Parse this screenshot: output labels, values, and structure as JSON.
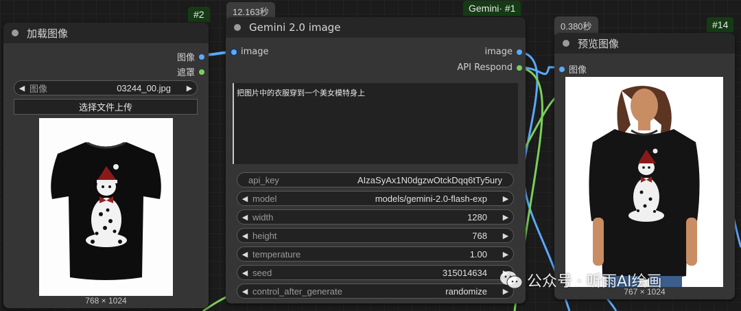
{
  "load_node": {
    "badge": "#2",
    "title": "加载图像",
    "outputs": [
      "图像",
      "遮罩"
    ],
    "image_widget": {
      "label": "图像",
      "value": "03244_00.jpg"
    },
    "upload_label": "选择文件上传",
    "image_dims": "768 × 1024"
  },
  "gemini_node": {
    "badge": "Gemini·  #1",
    "time": "12.163秒",
    "title": "Gemini 2.0 image",
    "input": "image",
    "outputs": [
      "image",
      "API Respond"
    ],
    "prompt": "把图片中的衣服穿到一个美女模特身上",
    "widgets": [
      {
        "label": "api_key",
        "value": "AIzaSyAx1N0dgzwOtckDqq6tTy5ury"
      },
      {
        "label": "model",
        "value": "models/gemini-2.0-flash-exp"
      },
      {
        "label": "width",
        "value": "1280"
      },
      {
        "label": "height",
        "value": "768"
      },
      {
        "label": "temperature",
        "value": "1.00"
      },
      {
        "label": "seed",
        "value": "315014634"
      },
      {
        "label": "control_after_generate",
        "value": "randomize"
      }
    ]
  },
  "preview_node": {
    "badge": "#14",
    "time": "0.380秒",
    "title": "预览图像",
    "input": "图像",
    "image_dims": "767 × 1024"
  },
  "watermark": "公众号 · 听雨AI绘画",
  "colors": {
    "image_port": "#5aa9ff",
    "mask_port": "#7bd05a",
    "badge_bg": "#153b15"
  }
}
